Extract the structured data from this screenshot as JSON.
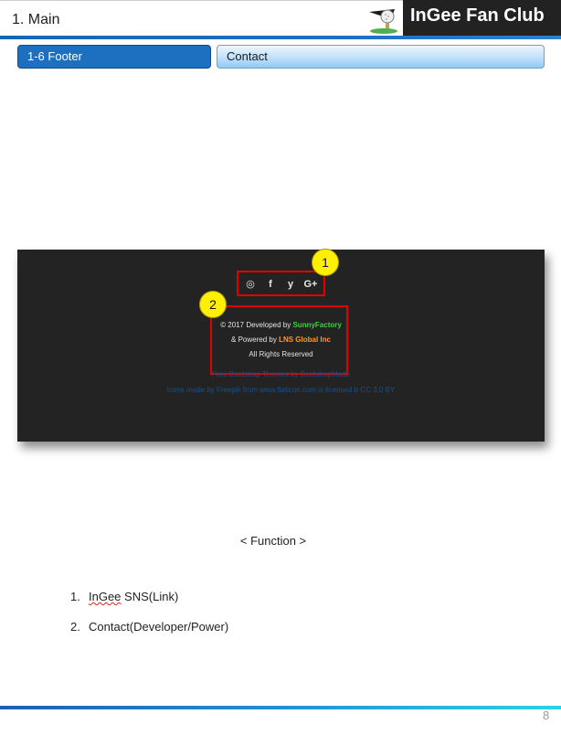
{
  "header": {
    "page_title": "1. Main",
    "brand": "InGee Fan Club",
    "logo_icon": "golf-ball-tee-icon"
  },
  "tabs": {
    "section": "1-6  Footer",
    "contact": "Contact"
  },
  "footer_screenshot": {
    "sns_icons": [
      {
        "name": "instagram-icon",
        "glyph": "◎"
      },
      {
        "name": "facebook-icon",
        "glyph": "f"
      },
      {
        "name": "twitter-icon",
        "glyph": "y"
      },
      {
        "name": "google-plus-icon",
        "glyph": "G+"
      }
    ],
    "developed_prefix": "© 2017 Developed by ",
    "developer": "SunnyFactory",
    "powered_prefix": "& Powered by ",
    "power": "LNS Global Inc",
    "rights": "All Rights Reserved",
    "theme_line": "Free Bootstrap Themes by BootstrapMade",
    "icons_line": "Icons made by Freepik from www.flaticon.com is licensed b CC 3.0 BY",
    "badge_1": "1",
    "badge_2": "2"
  },
  "function": {
    "heading": "< Function >",
    "items": [
      {
        "num": "1.",
        "lead": "InGee",
        "rest": " SNS(Link)"
      },
      {
        "num": "2.",
        "lead": "Contact(Developer/Power)",
        "rest": ""
      }
    ]
  },
  "page_number": "8",
  "colors": {
    "accent_blue": "#1d6fbf",
    "highlight_red": "#e00000",
    "badge_yellow": "#ffef00",
    "developer_green": "#36d636",
    "power_orange": "#ff9a1a"
  }
}
